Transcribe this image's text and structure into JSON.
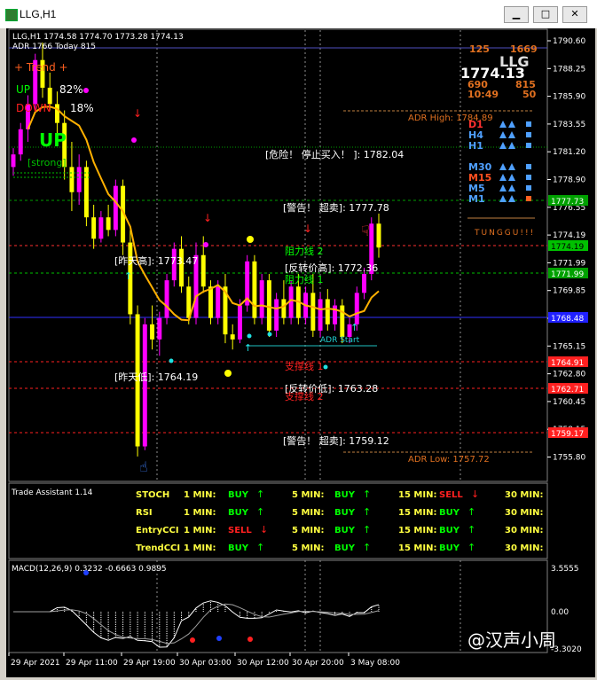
{
  "window": {
    "title": "LLG,H1",
    "btn_min": "▁",
    "btn_max": "□",
    "btn_close": "✕"
  },
  "colors": {
    "bg": "#000000",
    "bull": "#ff00ff",
    "bear": "#ffff00",
    "ma": "#ffb000",
    "axis_text": "#ffffff",
    "green_line": "#00c000",
    "red_line": "#ff2020",
    "blue_line": "#2020ff"
  },
  "main": {
    "header_line1": "LLG,H1  1774.58 1774.70 1773.28 1774.13",
    "header_line2": "ADR 1766 Today 815",
    "trend_label": "+   Trend   +",
    "up_label": "UP",
    "up_pct": "82%",
    "down_label": "DOWN",
    "down_pct": "18%",
    "big_up": "UP",
    "strong": "[strong]",
    "top_right": {
      "n1": "125",
      "n2": "1669",
      "symbol": "LLG",
      "price": "1774.13",
      "n3": "690",
      "n4": "815",
      "time": "10:49",
      "n5": "50"
    },
    "tf_labels": [
      "D1",
      "H4",
      "H1",
      "M30",
      "M15",
      "M5",
      "M1"
    ],
    "brand": "TUNGGU!!!",
    "annotations": {
      "danger": "[危险！ 停止买入！ ]: 1782.04",
      "warn_sell1": "[警告！ 超卖]: 1777.78",
      "resist2": "阻力线 2",
      "resist1": "阻力线 1",
      "yest_high": "[昨天高]: 1773.47",
      "rev_high": "[反转价高]: 1772.36",
      "adr_start": "ADR Start",
      "support1": "支撑线 1",
      "yest_low": "[昨天低]: 1764.19",
      "rev_low": "[反转价低]: 1763.28",
      "support2": "支撑线 2",
      "warn_sell2": "[警告！ 超卖]: 1759.12",
      "adr_high": "ADR High: 1784.89",
      "adr_low": "ADR Low: 1757.72"
    },
    "price_ticks": [
      "1790.60",
      "1788.25",
      "1785.90",
      "1783.55",
      "1781.20",
      "1778.90",
      "1776.55",
      "1774.19",
      "1771.99",
      "1769.85",
      "1767.50",
      "1765.15",
      "1762.80",
      "1760.45",
      "1758.15",
      "1755.80"
    ],
    "price_tags": [
      "1777.73",
      "1774.19",
      "1771.99",
      "1768.48",
      "1764.91",
      "1762.71",
      "1759.17"
    ]
  },
  "trade": {
    "title": "Trade Assistant 1.14",
    "rows": [
      {
        "name": "STOCH",
        "cells": [
          [
            "1 MIN:",
            "BUY"
          ],
          [
            "5 MIN:",
            "BUY"
          ],
          [
            "15 MIN:",
            "SELL"
          ],
          [
            "30 MIN:",
            ""
          ]
        ]
      },
      {
        "name": "RSI",
        "cells": [
          [
            "1 MIN:",
            "BUY"
          ],
          [
            "5 MIN:",
            "BUY"
          ],
          [
            "15 MIN:",
            "BUY"
          ],
          [
            "30 MIN:",
            ""
          ]
        ]
      },
      {
        "name": "EntryCCI",
        "cells": [
          [
            "1 MIN:",
            "SELL"
          ],
          [
            "5 MIN:",
            "BUY"
          ],
          [
            "15 MIN:",
            "BUY"
          ],
          [
            "30 MIN:",
            ""
          ]
        ]
      },
      {
        "name": "TrendCCI",
        "cells": [
          [
            "1 MIN:",
            "BUY"
          ],
          [
            "5 MIN:",
            "BUY"
          ],
          [
            "15 MIN:",
            "BUY"
          ],
          [
            "30 MIN:",
            ""
          ]
        ]
      }
    ]
  },
  "macd": {
    "label": "MACD(12,26,9) 0.3232 -0.6663 0.9895",
    "ticks": [
      "3.5555",
      "0.00",
      "-3.3020"
    ]
  },
  "time_axis": [
    "29 Apr 2021",
    "29 Apr 11:00",
    "29 Apr 19:00",
    "30 Apr 03:00",
    "30 Apr 12:00",
    "30 Apr 20:00",
    "3 May 08:00"
  ],
  "watermark": "@汉声小周",
  "chart_data": {
    "type": "candlestick",
    "symbol": "LLG",
    "timeframe": "H1",
    "ylim": [
      1755.8,
      1790.6
    ],
    "x": [
      "29 Apr 2021",
      "29 Apr 11:00",
      "29 Apr 19:00",
      "30 Apr 03:00",
      "30 Apr 12:00",
      "30 Apr 20:00",
      "3 May 08:00"
    ],
    "candles": [
      [
        1780.5,
        1782.0,
        1779.8,
        1781.5
      ],
      [
        1781.5,
        1784.0,
        1781.0,
        1783.5
      ],
      [
        1783.5,
        1786.2,
        1782.5,
        1785.5
      ],
      [
        1785.5,
        1789.5,
        1784.8,
        1789.0
      ],
      [
        1789.0,
        1790.4,
        1786.0,
        1786.8
      ],
      [
        1786.8,
        1788.0,
        1785.0,
        1785.5
      ],
      [
        1785.5,
        1786.5,
        1783.0,
        1784.0
      ],
      [
        1784.0,
        1785.0,
        1779.5,
        1780.5
      ],
      [
        1780.5,
        1782.5,
        1777.0,
        1778.5
      ],
      [
        1778.5,
        1781.5,
        1777.5,
        1780.5
      ],
      [
        1780.5,
        1781.0,
        1775.8,
        1776.5
      ],
      [
        1776.5,
        1777.5,
        1774.0,
        1774.8
      ],
      [
        1774.8,
        1777.0,
        1774.5,
        1776.5
      ],
      [
        1776.5,
        1777.5,
        1775.0,
        1775.5
      ],
      [
        1775.5,
        1779.5,
        1775.0,
        1779.0
      ],
      [
        1779.0,
        1779.5,
        1773.5,
        1774.5
      ],
      [
        1774.5,
        1775.5,
        1768.0,
        1768.8
      ],
      [
        1768.8,
        1769.5,
        1757.5,
        1758.3
      ],
      [
        1758.3,
        1768.5,
        1758.0,
        1768.0
      ],
      [
        1768.0,
        1769.5,
        1766.0,
        1766.8
      ],
      [
        1766.8,
        1769.0,
        1765.5,
        1768.5
      ],
      [
        1768.5,
        1772.0,
        1768.0,
        1771.5
      ],
      [
        1771.5,
        1774.5,
        1771.0,
        1774.0
      ],
      [
        1774.0,
        1775.0,
        1770.5,
        1771.0
      ],
      [
        1771.0,
        1771.8,
        1768.0,
        1768.5
      ],
      [
        1768.5,
        1774.5,
        1768.0,
        1773.5
      ],
      [
        1773.5,
        1775.0,
        1770.5,
        1771.0
      ],
      [
        1771.0,
        1771.5,
        1768.0,
        1768.5
      ],
      [
        1768.5,
        1771.5,
        1768.0,
        1771.0
      ],
      [
        1771.0,
        1772.0,
        1766.5,
        1767.2
      ],
      [
        1767.2,
        1768.0,
        1766.0,
        1766.8
      ],
      [
        1766.8,
        1770.0,
        1766.5,
        1769.5
      ],
      [
        1769.5,
        1773.5,
        1769.0,
        1773.0
      ],
      [
        1773.0,
        1773.5,
        1768.0,
        1768.5
      ],
      [
        1768.5,
        1772.0,
        1768.0,
        1771.5
      ],
      [
        1771.5,
        1772.0,
        1767.0,
        1767.5
      ],
      [
        1767.5,
        1770.5,
        1767.0,
        1770.0
      ],
      [
        1770.0,
        1771.5,
        1768.0,
        1768.5
      ],
      [
        1768.5,
        1771.5,
        1768.0,
        1771.0
      ],
      [
        1771.0,
        1772.0,
        1768.0,
        1768.5
      ],
      [
        1768.5,
        1771.0,
        1768.0,
        1770.5
      ],
      [
        1770.5,
        1772.0,
        1767.0,
        1767.5
      ],
      [
        1767.5,
        1770.5,
        1767.0,
        1770.0
      ],
      [
        1770.0,
        1770.8,
        1767.5,
        1768.0
      ],
      [
        1768.0,
        1770.0,
        1767.5,
        1769.5
      ],
      [
        1769.5,
        1770.0,
        1766.5,
        1767.0
      ],
      [
        1767.0,
        1768.5,
        1766.5,
        1768.0
      ],
      [
        1768.0,
        1771.0,
        1767.5,
        1770.5
      ],
      [
        1770.5,
        1772.5,
        1770.0,
        1772.0
      ],
      [
        1772.0,
        1776.5,
        1771.5,
        1776.0
      ],
      [
        1776.0,
        1776.8,
        1773.3,
        1774.1
      ]
    ]
  }
}
